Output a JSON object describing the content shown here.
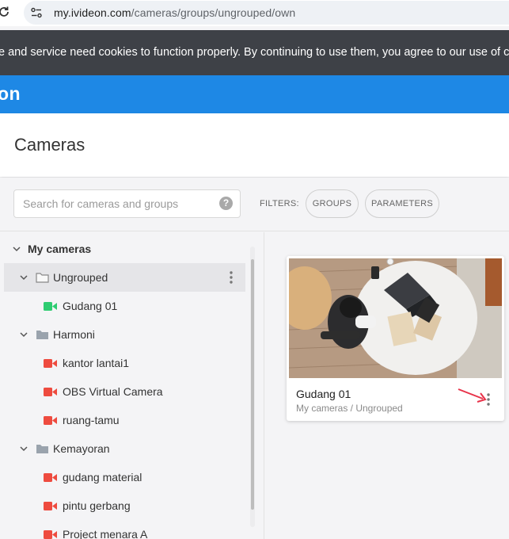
{
  "browser": {
    "url_host": "my.ivideon.com",
    "url_path": "/cameras/groups/ungrouped/own"
  },
  "cookie_banner": {
    "text": "e and service need cookies to function properly. By continuing to use them, you agree to our use of cooki"
  },
  "app": {
    "brand_partial": "on",
    "accent_color": "#1e88e5"
  },
  "page": {
    "title": "Cameras"
  },
  "toolbar": {
    "search_placeholder": "Search for cameras and groups",
    "help_label": "?",
    "filters_label": "FILTERS:",
    "groups_label": "GROUPS",
    "parameters_label": "PARAMETERS"
  },
  "sidebar": {
    "root_label": "My cameras",
    "items": [
      {
        "label": "Ungrouped",
        "type": "group",
        "icon": "folder-outline-icon"
      },
      {
        "label": "Gudang 01",
        "type": "camera",
        "status": "online"
      },
      {
        "label": "Harmoni",
        "type": "group",
        "icon": "folder-icon"
      },
      {
        "label": "kantor lantai1",
        "type": "camera",
        "status": "offline"
      },
      {
        "label": "OBS Virtual Camera",
        "type": "camera",
        "status": "offline"
      },
      {
        "label": "ruang-tamu",
        "type": "camera",
        "status": "offline"
      },
      {
        "label": "Kemayoran",
        "type": "group",
        "icon": "folder-icon"
      },
      {
        "label": "gudang material",
        "type": "camera",
        "status": "offline"
      },
      {
        "label": "pintu gerbang",
        "type": "camera",
        "status": "offline"
      },
      {
        "label": "Project menara A",
        "type": "camera",
        "status": "offline"
      }
    ],
    "status_colors": {
      "online": "#2ecc71",
      "offline": "#ee4b3f"
    }
  },
  "card": {
    "title": "Gudang 01",
    "subtitle": "My cameras / Ungrouped"
  }
}
